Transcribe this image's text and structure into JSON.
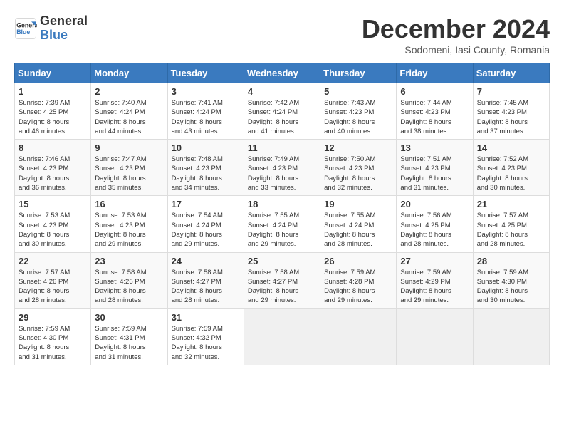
{
  "header": {
    "logo_line1": "General",
    "logo_line2": "Blue",
    "month": "December 2024",
    "location": "Sodomeni, Iasi County, Romania"
  },
  "days_of_week": [
    "Sunday",
    "Monday",
    "Tuesday",
    "Wednesday",
    "Thursday",
    "Friday",
    "Saturday"
  ],
  "weeks": [
    [
      {
        "day": 1,
        "info": "Sunrise: 7:39 AM\nSunset: 4:25 PM\nDaylight: 8 hours\nand 46 minutes."
      },
      {
        "day": 2,
        "info": "Sunrise: 7:40 AM\nSunset: 4:24 PM\nDaylight: 8 hours\nand 44 minutes."
      },
      {
        "day": 3,
        "info": "Sunrise: 7:41 AM\nSunset: 4:24 PM\nDaylight: 8 hours\nand 43 minutes."
      },
      {
        "day": 4,
        "info": "Sunrise: 7:42 AM\nSunset: 4:24 PM\nDaylight: 8 hours\nand 41 minutes."
      },
      {
        "day": 5,
        "info": "Sunrise: 7:43 AM\nSunset: 4:23 PM\nDaylight: 8 hours\nand 40 minutes."
      },
      {
        "day": 6,
        "info": "Sunrise: 7:44 AM\nSunset: 4:23 PM\nDaylight: 8 hours\nand 38 minutes."
      },
      {
        "day": 7,
        "info": "Sunrise: 7:45 AM\nSunset: 4:23 PM\nDaylight: 8 hours\nand 37 minutes."
      }
    ],
    [
      {
        "day": 8,
        "info": "Sunrise: 7:46 AM\nSunset: 4:23 PM\nDaylight: 8 hours\nand 36 minutes."
      },
      {
        "day": 9,
        "info": "Sunrise: 7:47 AM\nSunset: 4:23 PM\nDaylight: 8 hours\nand 35 minutes."
      },
      {
        "day": 10,
        "info": "Sunrise: 7:48 AM\nSunset: 4:23 PM\nDaylight: 8 hours\nand 34 minutes."
      },
      {
        "day": 11,
        "info": "Sunrise: 7:49 AM\nSunset: 4:23 PM\nDaylight: 8 hours\nand 33 minutes."
      },
      {
        "day": 12,
        "info": "Sunrise: 7:50 AM\nSunset: 4:23 PM\nDaylight: 8 hours\nand 32 minutes."
      },
      {
        "day": 13,
        "info": "Sunrise: 7:51 AM\nSunset: 4:23 PM\nDaylight: 8 hours\nand 31 minutes."
      },
      {
        "day": 14,
        "info": "Sunrise: 7:52 AM\nSunset: 4:23 PM\nDaylight: 8 hours\nand 30 minutes."
      }
    ],
    [
      {
        "day": 15,
        "info": "Sunrise: 7:53 AM\nSunset: 4:23 PM\nDaylight: 8 hours\nand 30 minutes."
      },
      {
        "day": 16,
        "info": "Sunrise: 7:53 AM\nSunset: 4:23 PM\nDaylight: 8 hours\nand 29 minutes."
      },
      {
        "day": 17,
        "info": "Sunrise: 7:54 AM\nSunset: 4:24 PM\nDaylight: 8 hours\nand 29 minutes."
      },
      {
        "day": 18,
        "info": "Sunrise: 7:55 AM\nSunset: 4:24 PM\nDaylight: 8 hours\nand 29 minutes."
      },
      {
        "day": 19,
        "info": "Sunrise: 7:55 AM\nSunset: 4:24 PM\nDaylight: 8 hours\nand 28 minutes."
      },
      {
        "day": 20,
        "info": "Sunrise: 7:56 AM\nSunset: 4:25 PM\nDaylight: 8 hours\nand 28 minutes."
      },
      {
        "day": 21,
        "info": "Sunrise: 7:57 AM\nSunset: 4:25 PM\nDaylight: 8 hours\nand 28 minutes."
      }
    ],
    [
      {
        "day": 22,
        "info": "Sunrise: 7:57 AM\nSunset: 4:26 PM\nDaylight: 8 hours\nand 28 minutes."
      },
      {
        "day": 23,
        "info": "Sunrise: 7:58 AM\nSunset: 4:26 PM\nDaylight: 8 hours\nand 28 minutes."
      },
      {
        "day": 24,
        "info": "Sunrise: 7:58 AM\nSunset: 4:27 PM\nDaylight: 8 hours\nand 28 minutes."
      },
      {
        "day": 25,
        "info": "Sunrise: 7:58 AM\nSunset: 4:27 PM\nDaylight: 8 hours\nand 29 minutes."
      },
      {
        "day": 26,
        "info": "Sunrise: 7:59 AM\nSunset: 4:28 PM\nDaylight: 8 hours\nand 29 minutes."
      },
      {
        "day": 27,
        "info": "Sunrise: 7:59 AM\nSunset: 4:29 PM\nDaylight: 8 hours\nand 29 minutes."
      },
      {
        "day": 28,
        "info": "Sunrise: 7:59 AM\nSunset: 4:30 PM\nDaylight: 8 hours\nand 30 minutes."
      }
    ],
    [
      {
        "day": 29,
        "info": "Sunrise: 7:59 AM\nSunset: 4:30 PM\nDaylight: 8 hours\nand 31 minutes."
      },
      {
        "day": 30,
        "info": "Sunrise: 7:59 AM\nSunset: 4:31 PM\nDaylight: 8 hours\nand 31 minutes."
      },
      {
        "day": 31,
        "info": "Sunrise: 7:59 AM\nSunset: 4:32 PM\nDaylight: 8 hours\nand 32 minutes."
      },
      null,
      null,
      null,
      null
    ]
  ]
}
